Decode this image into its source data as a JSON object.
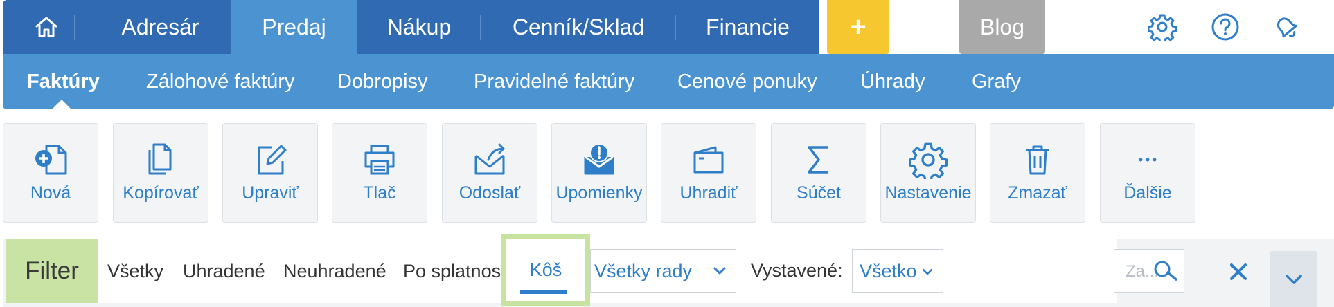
{
  "topnav": {
    "items": [
      {
        "label": "Adresár"
      },
      {
        "label": "Predaj",
        "active": true
      },
      {
        "label": "Nákup"
      },
      {
        "label": "Cenník/Sklad"
      },
      {
        "label": "Financie"
      }
    ],
    "plus_label": "+",
    "blog_label": "Blog",
    "icons": [
      "home-icon",
      "gear-icon",
      "help-icon",
      "notification-bell-icon"
    ]
  },
  "subnav": {
    "items": [
      {
        "label": "Faktúry",
        "active": true
      },
      {
        "label": "Zálohové faktúry"
      },
      {
        "label": "Dobropisy"
      },
      {
        "label": "Pravidelné faktúry"
      },
      {
        "label": "Cenové ponuky"
      },
      {
        "label": "Úhrady"
      },
      {
        "label": "Grafy"
      }
    ]
  },
  "toolbar": {
    "buttons": [
      {
        "label": "Nová",
        "icon": "new-document-icon"
      },
      {
        "label": "Kopírovať",
        "icon": "copy-icon"
      },
      {
        "label": "Upraviť",
        "icon": "edit-icon"
      },
      {
        "label": "Tlač",
        "icon": "print-icon"
      },
      {
        "label": "Odoslať",
        "icon": "send-icon"
      },
      {
        "label": "Upomienky",
        "icon": "reminder-icon"
      },
      {
        "label": "Uhradiť",
        "icon": "wallet-icon"
      },
      {
        "label": "Súčet",
        "icon": "sum-icon"
      },
      {
        "label": "Nastavenie",
        "icon": "gear-icon"
      },
      {
        "label": "Zmazať",
        "icon": "trash-icon"
      },
      {
        "label": "Ďalšie",
        "icon": "more-icon"
      }
    ]
  },
  "filter": {
    "label": "Filter",
    "options": [
      "Všetky",
      "Uhradené",
      "Neuhradené",
      "Po splatnosti"
    ],
    "active_option": "Kôš",
    "series_select": "Všetky rady",
    "issued_label": "Vystavené:",
    "issued_select": "Všetko",
    "search_placeholder": "Za...",
    "colors": {
      "accent": "#2e7ec9",
      "highlight": "#c6e3a0"
    }
  },
  "colors": {
    "topnav_bg": "#2f6ab3",
    "subnav_bg": "#4b93d1",
    "plus_bg": "#f7c72f",
    "blog_bg": "#a9a9a9"
  }
}
